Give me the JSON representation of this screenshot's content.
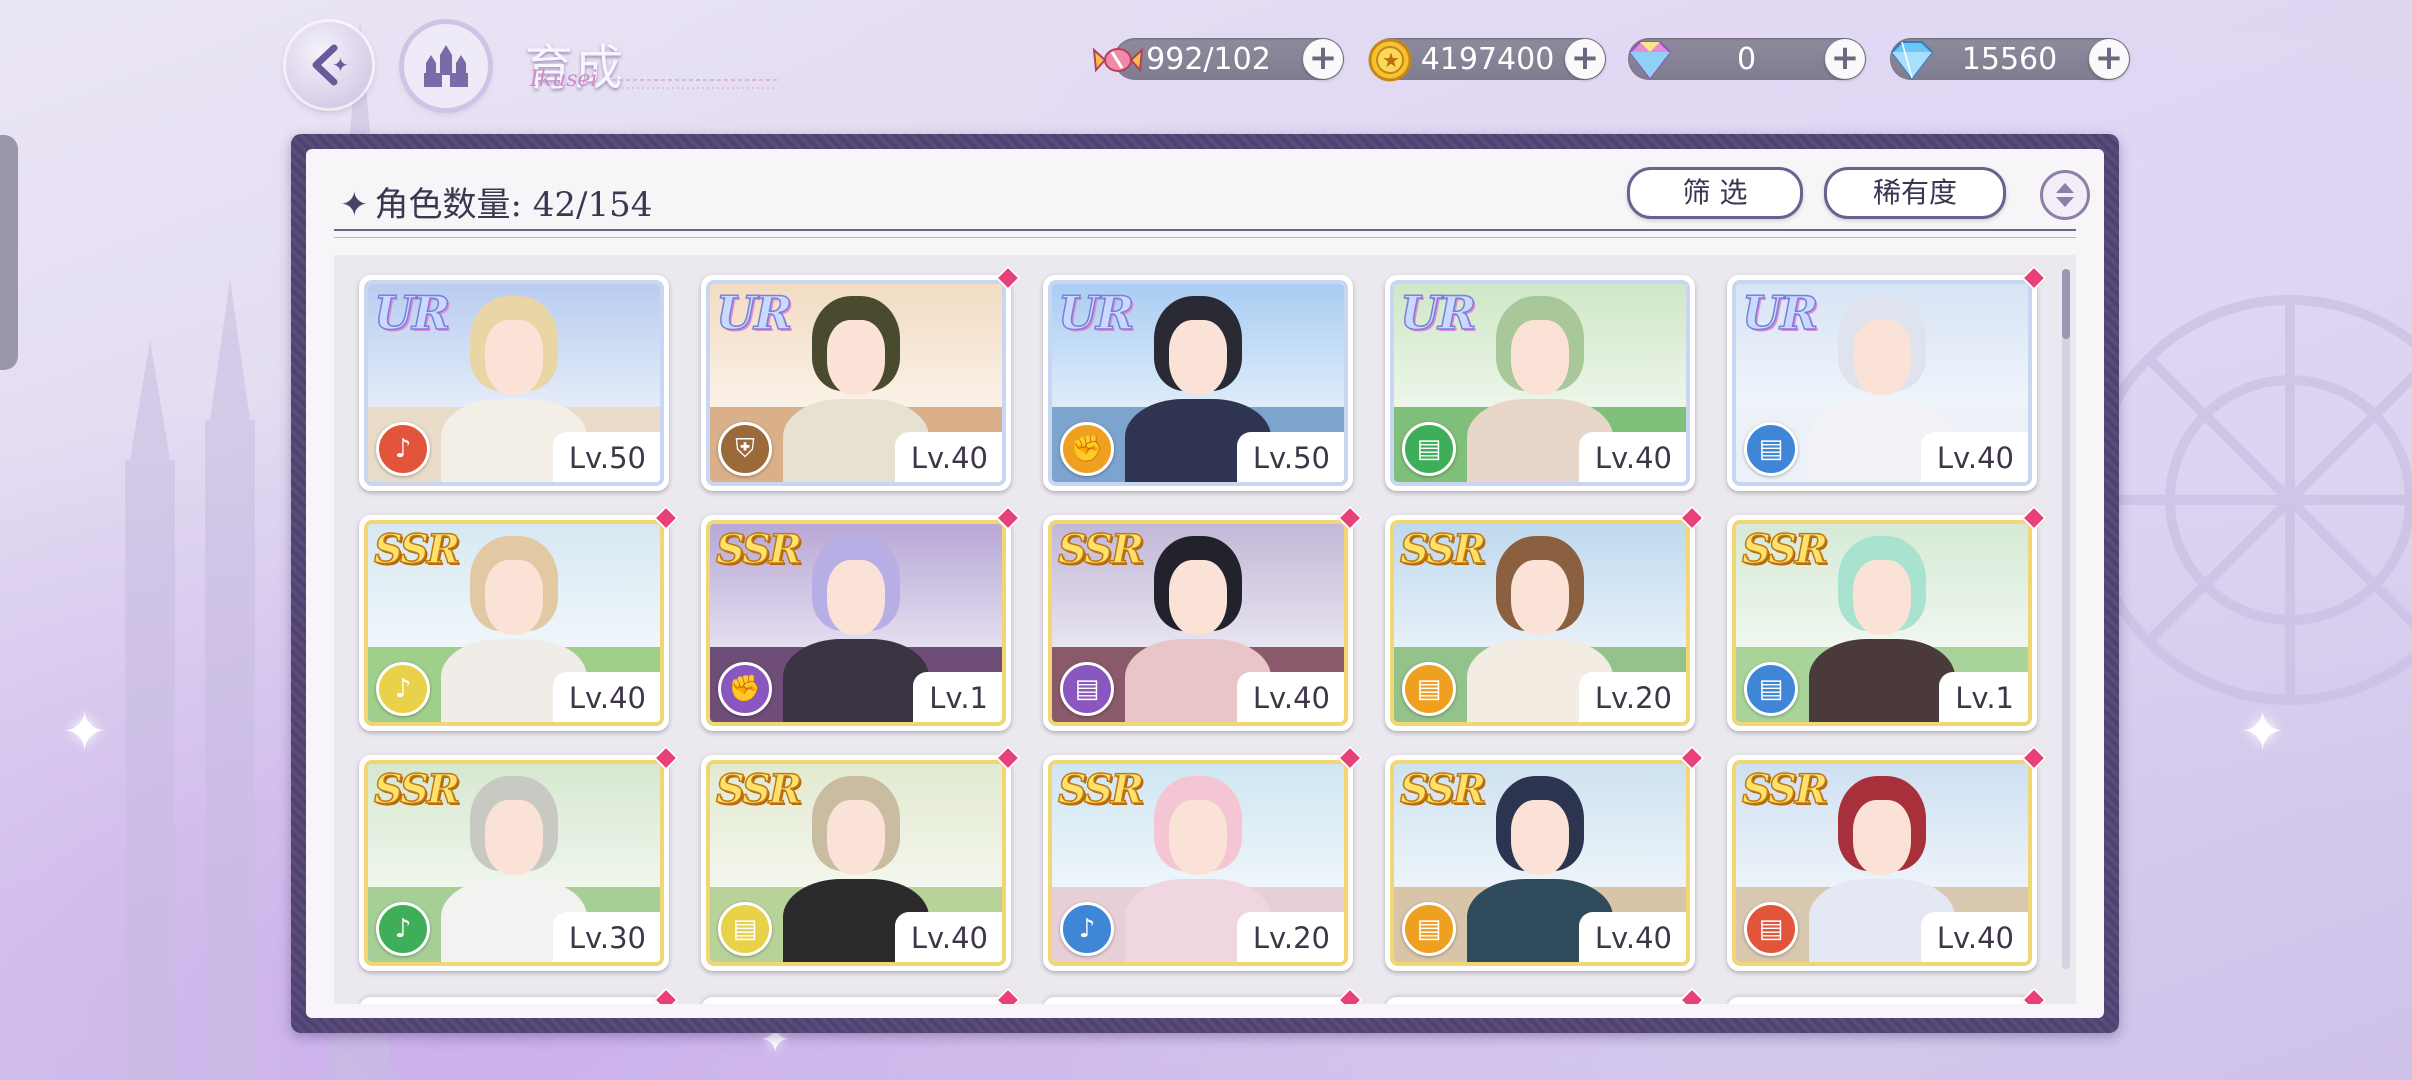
{
  "header": {
    "title": "育成",
    "title_script": "Ikusei"
  },
  "resources": [
    {
      "icon": "candy-icon",
      "value": "992/102"
    },
    {
      "icon": "gold-coin-icon",
      "value": "4197400"
    },
    {
      "icon": "rainbow-gem-icon",
      "value": "0"
    },
    {
      "icon": "diamond-icon",
      "value": "15560"
    }
  ],
  "panel": {
    "count_label": "角色数量: 42/154",
    "filter_label": "筛 选",
    "sort_label": "稀有度"
  },
  "colors": {
    "panel_frame": "#4f4170",
    "new_marker": "#e8417a",
    "element_red": "#e2553a",
    "element_brown": "#9a6a3a",
    "element_orange": "#f0a020",
    "element_green": "#3fae58",
    "element_blue": "#3f86d6",
    "element_yellow": "#e9d24a",
    "element_purple": "#8a56c0"
  },
  "cards": [
    {
      "rarity": "UR",
      "level": "Lv.50",
      "element": "red",
      "element_icon": "trumpet-icon",
      "new": false,
      "sky": "#b9cdf0",
      "ground": "#e8dcc8",
      "hair": "#ead5a4",
      "outfit": "#f3efe6"
    },
    {
      "rarity": "UR",
      "level": "Lv.40",
      "element": "brown",
      "element_icon": "shield-icon",
      "new": true,
      "sky": "#f2dcc2",
      "ground": "#d9b08a",
      "hair": "#4a4a2e",
      "outfit": "#e7e1d2"
    },
    {
      "rarity": "UR",
      "level": "Lv.50",
      "element": "orange",
      "element_icon": "fist-icon",
      "new": false,
      "sky": "#a9cdf2",
      "ground": "#7da3cf",
      "hair": "#2a2a35",
      "outfit": "#2f3550"
    },
    {
      "rarity": "UR",
      "level": "Lv.40",
      "element": "green",
      "element_icon": "card-icon",
      "new": false,
      "sky": "#cfe7c7",
      "ground": "#7fbf7a",
      "hair": "#a8c89a",
      "outfit": "#e8d7c8"
    },
    {
      "rarity": "UR",
      "level": "Lv.40",
      "element": "blue",
      "element_icon": "card-icon",
      "new": true,
      "sky": "#d7e4f5",
      "ground": "#ecf1f8",
      "hair": "#dfe3ee",
      "outfit": "#f2f2f6"
    },
    {
      "rarity": "SSR",
      "level": "Lv.40",
      "element": "yellow",
      "element_icon": "trumpet-icon",
      "new": true,
      "sky": "#d7e8f2",
      "ground": "#9fcf8a",
      "hair": "#e2c9a4",
      "outfit": "#f0ede8"
    },
    {
      "rarity": "SSR",
      "level": "Lv.1",
      "element": "purple",
      "element_icon": "fist-icon",
      "new": true,
      "sky": "#b8a8d6",
      "ground": "#6e4e78",
      "hair": "#b7aee6",
      "outfit": "#3a3442"
    },
    {
      "rarity": "SSR",
      "level": "Lv.40",
      "element": "purple",
      "element_icon": "card-icon",
      "new": true,
      "sky": "#c2b8d8",
      "ground": "#8a5a6a",
      "hair": "#22222c",
      "outfit": "#e8c6c8"
    },
    {
      "rarity": "SSR",
      "level": "Lv.20",
      "element": "orange",
      "element_icon": "card-icon",
      "new": true,
      "sky": "#bfd9ee",
      "ground": "#93c28a",
      "hair": "#8a6040",
      "outfit": "#f3ece2"
    },
    {
      "rarity": "SSR",
      "level": "Lv.1",
      "element": "blue",
      "element_icon": "card-icon",
      "new": true,
      "sky": "#d6ead6",
      "ground": "#a8d49a",
      "hair": "#a9e3d0",
      "outfit": "#4a3a3a"
    },
    {
      "rarity": "SSR",
      "level": "Lv.30",
      "element": "green",
      "element_icon": "trumpet-icon",
      "new": true,
      "sky": "#d6e8d0",
      "ground": "#a6cf96",
      "hair": "#c9c9c4",
      "outfit": "#f2f2f0"
    },
    {
      "rarity": "SSR",
      "level": "Lv.40",
      "element": "yellow",
      "element_icon": "card-icon",
      "new": true,
      "sky": "#e2ead0",
      "ground": "#b9d29a",
      "hair": "#c9bca0",
      "outfit": "#2c2a2c"
    },
    {
      "rarity": "SSR",
      "level": "Lv.20",
      "element": "blue",
      "element_icon": "trumpet-icon",
      "new": true,
      "sky": "#d0e6f2",
      "ground": "#e6cfd6",
      "hair": "#f4c6d4",
      "outfit": "#f0d6e0"
    },
    {
      "rarity": "SSR",
      "level": "Lv.40",
      "element": "orange",
      "element_icon": "card-icon",
      "new": true,
      "sky": "#cfe2f0",
      "ground": "#d8c4a8",
      "hair": "#2c3450",
      "outfit": "#2f4a5a"
    },
    {
      "rarity": "SSR",
      "level": "Lv.40",
      "element": "red",
      "element_icon": "card-icon",
      "new": true,
      "sky": "#cfe0f2",
      "ground": "#d9c8b0",
      "hair": "#a8303a",
      "outfit": "#e4e8f2"
    }
  ]
}
